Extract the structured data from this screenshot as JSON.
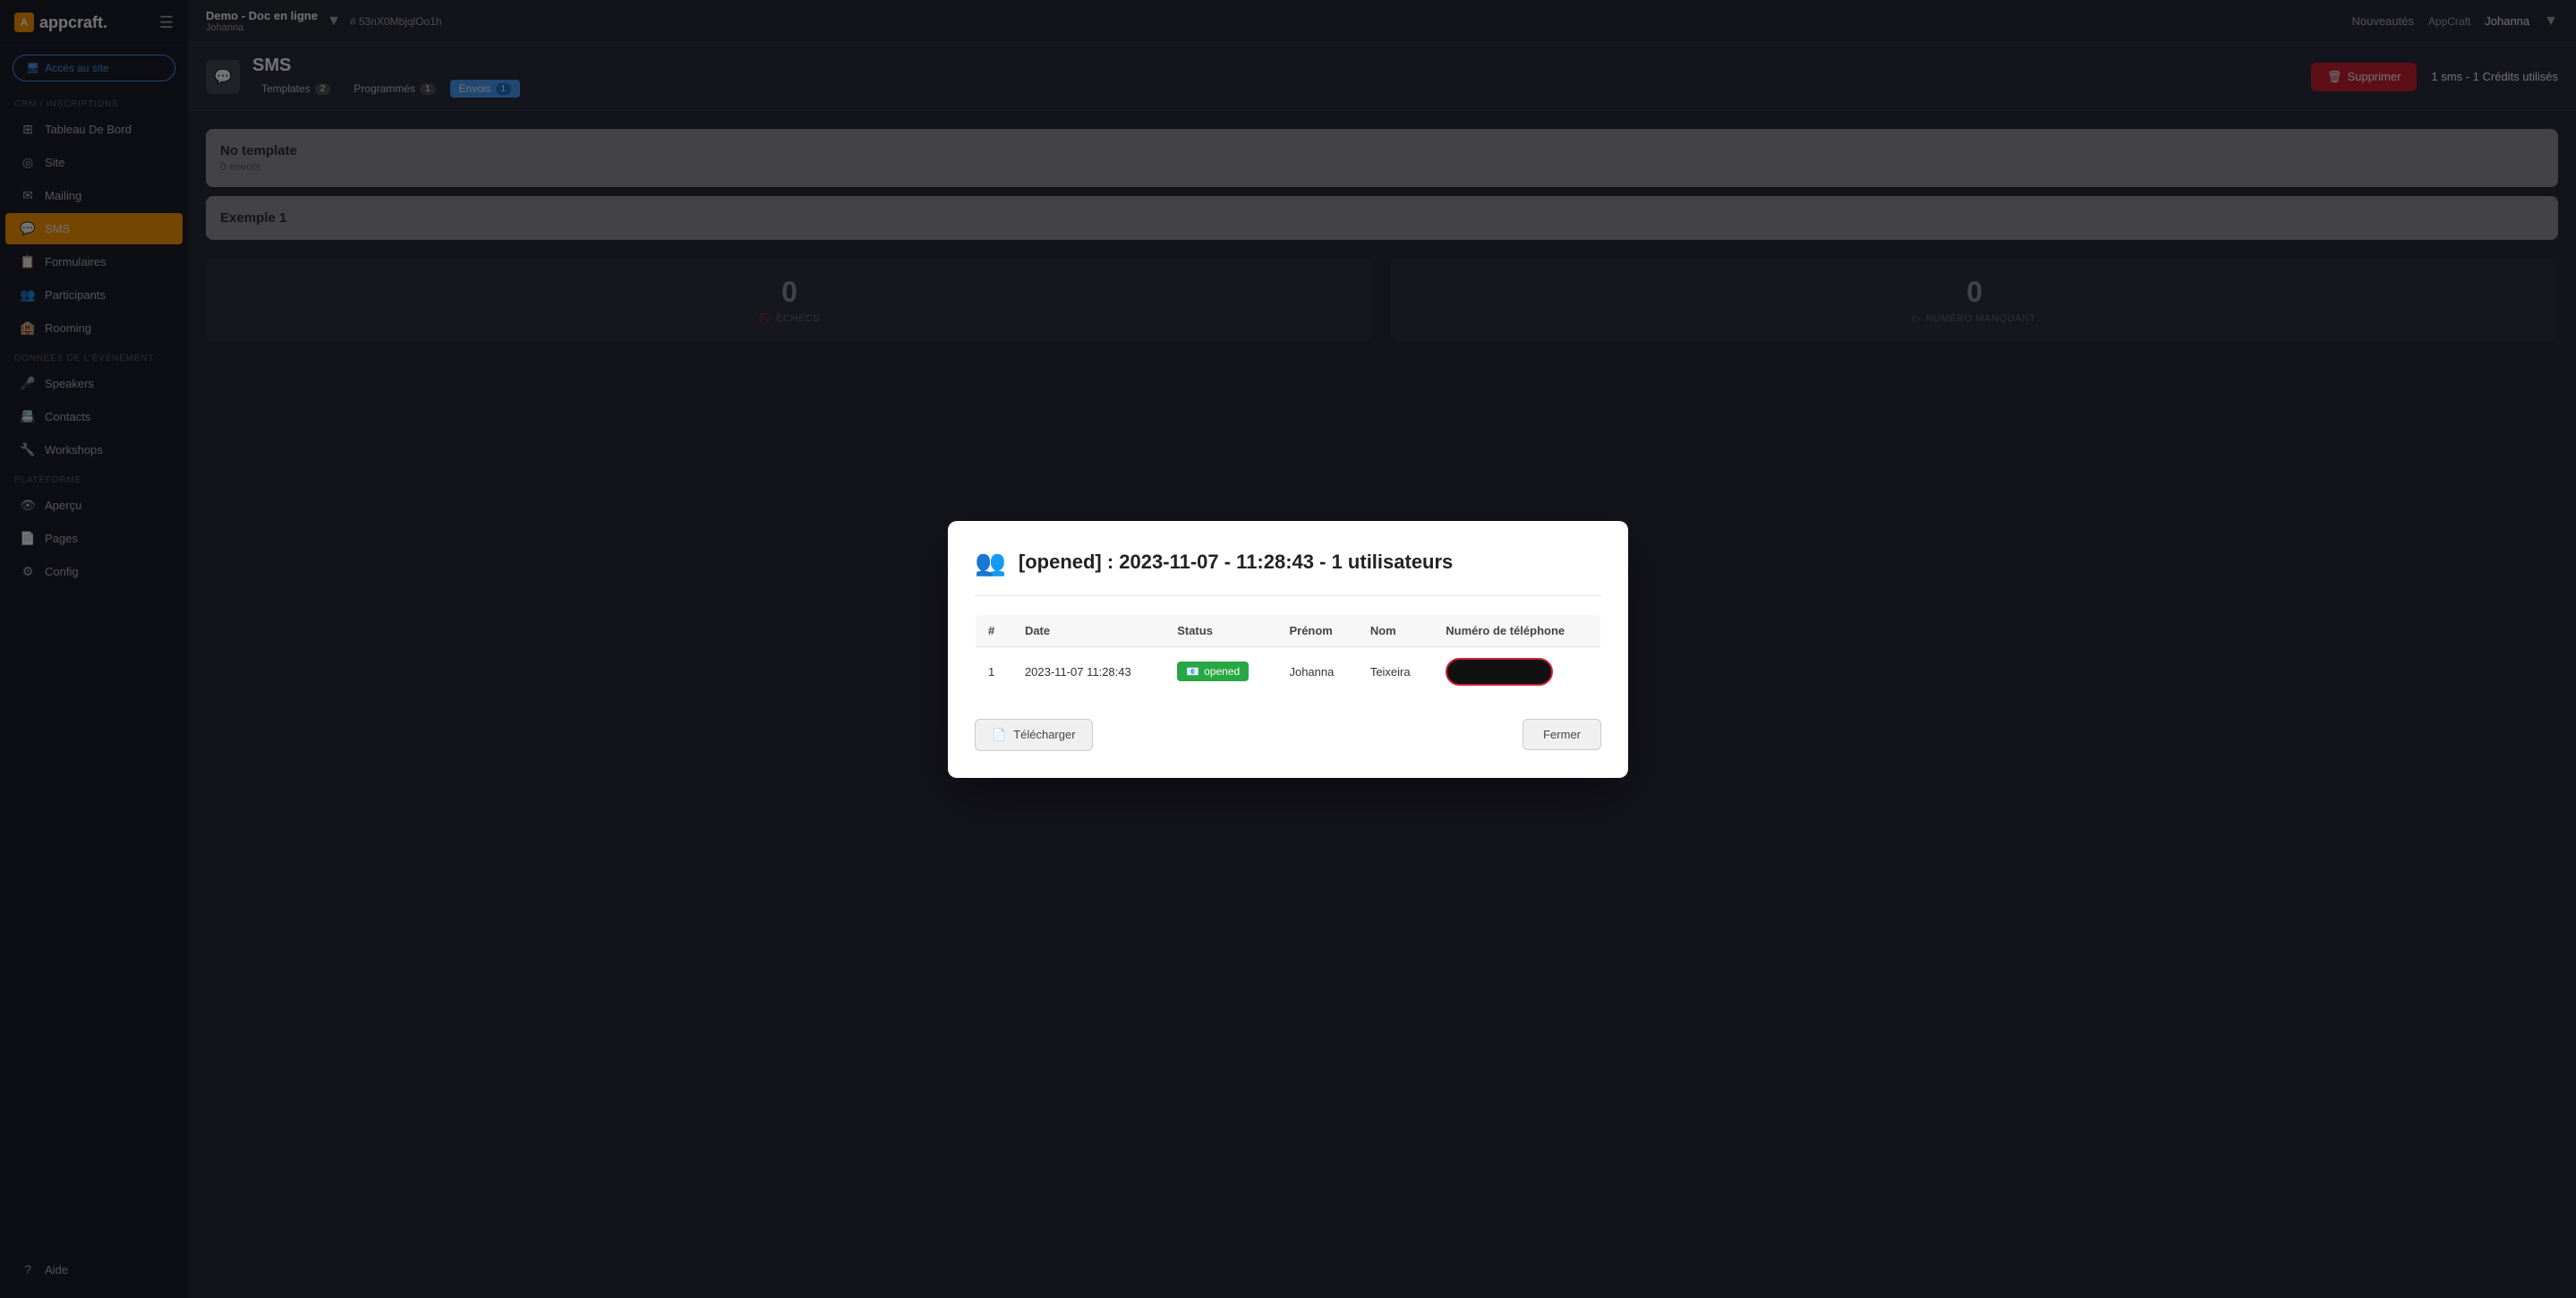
{
  "app": {
    "logo_text": "appcraft.",
    "logo_icon": "A"
  },
  "sidebar": {
    "access_btn": "Accès au site",
    "section_crm": "CRM / INSCRIPTIONS",
    "section_data": "DONNÉES DE L'ÉVÉNEMENT",
    "section_platform": "PLATEFORME",
    "items": [
      {
        "id": "tableau-de-bord",
        "label": "Tableau De Bord",
        "icon": "⊞"
      },
      {
        "id": "site",
        "label": "Site",
        "icon": "◎"
      },
      {
        "id": "mailing",
        "label": "Mailing",
        "icon": "✉"
      },
      {
        "id": "sms",
        "label": "SMS",
        "icon": "💬",
        "active": true
      },
      {
        "id": "formulaires",
        "label": "Formulaires",
        "icon": "📋"
      },
      {
        "id": "participants",
        "label": "Participants",
        "icon": "👥"
      },
      {
        "id": "rooming",
        "label": "Rooming",
        "icon": "🏨"
      },
      {
        "id": "speakers",
        "label": "Speakers",
        "icon": "🎤"
      },
      {
        "id": "contacts",
        "label": "Contacts",
        "icon": "📇"
      },
      {
        "id": "workshops",
        "label": "Workshops",
        "icon": "🔧"
      },
      {
        "id": "apercu",
        "label": "Aperçu",
        "icon": "👁"
      },
      {
        "id": "pages",
        "label": "Pages",
        "icon": "📄"
      },
      {
        "id": "config",
        "label": "Config",
        "icon": "⚙"
      },
      {
        "id": "aide",
        "label": "Aide",
        "icon": "?"
      }
    ]
  },
  "topbar": {
    "project_name": "Demo - Doc en ligne",
    "project_sub": "Johanna",
    "hash": "# 53nX0MbjqlOo1h",
    "nouveautes": "Nouveautés",
    "appcraft": "AppCraft",
    "user": "Johanna"
  },
  "page": {
    "title": "SMS",
    "tabs": [
      {
        "id": "templates",
        "label": "Templates",
        "badge": "2",
        "active": false
      },
      {
        "id": "programmes",
        "label": "Programmés",
        "badge": "1",
        "active": false
      },
      {
        "id": "envois",
        "label": "Envois",
        "badge": "1",
        "active": true
      }
    ],
    "delete_btn": "Supprimer",
    "credits_text": "1 sms - 1 Crédits utilisés"
  },
  "bg_cards": [
    {
      "title": "No template",
      "sub": "0 envois"
    },
    {
      "title": "Exemple 1",
      "sub": ""
    }
  ],
  "modal": {
    "icon": "👥",
    "title": "[opened] : 2023-11-07 - 11:28:43 - 1 utilisateurs",
    "table": {
      "columns": [
        "#",
        "Date",
        "Status",
        "Prénom",
        "Nom",
        "Numéro de téléphone"
      ],
      "rows": [
        {
          "num": "1",
          "date": "2023-11-07 11:28:43",
          "status": "opened",
          "prenom": "Johanna",
          "nom": "Teixeira",
          "phone": "REDACTED"
        }
      ]
    },
    "download_btn": "Télécharger",
    "close_btn": "Fermer"
  },
  "bg_stats": {
    "echecs_label": "ÉCHECS",
    "echecs_value": "0",
    "numero_manquant_label": "NUMÉRO MANQUANT",
    "numero_manquant_value": "0"
  }
}
